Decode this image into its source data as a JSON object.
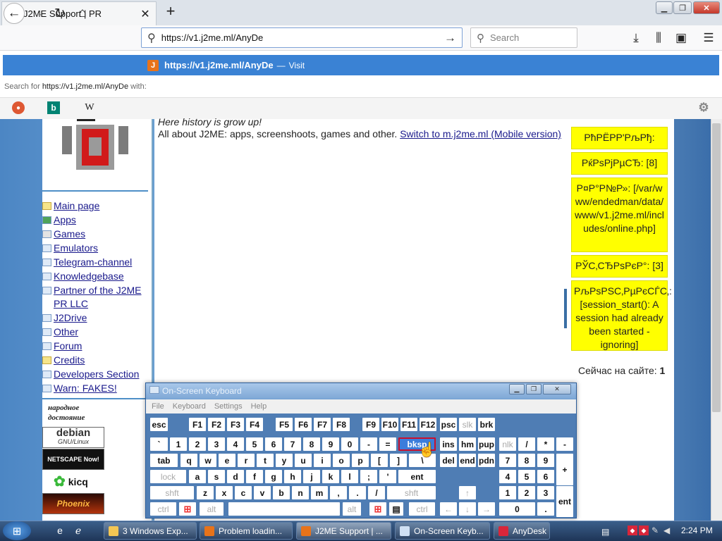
{
  "browser": {
    "tab_title": "J2ME Support | PR",
    "tab_favicon": "J",
    "url": "https://v1.j2me.ml/AnyDe",
    "search_placeholder": "Search",
    "dropdown": {
      "visit_url": "https://v1.j2me.ml/AnyDe",
      "visit_separator": "—",
      "visit_label": "Visit",
      "search_for_prefix": "Search for",
      "search_for_query": "https://v1.j2me.ml/AnyDe",
      "search_for_suffix": "with:",
      "engines": [
        "duckduckgo-icon",
        "bing-icon",
        "wikipedia-icon"
      ],
      "engine_labels": [
        "",
        "b",
        "W"
      ]
    },
    "icons": [
      "back-icon",
      "forward-icon",
      "reload-icon",
      "home-icon",
      "download-icon",
      "library-icon",
      "sidebar-icon",
      "menu-icon"
    ]
  },
  "page": {
    "tagline": "Here history is grow up!",
    "about_text": "All about J2ME: apps, screenshoots, games and other.",
    "switch_link": "Switch to m.j2me.ml (Mobile version)",
    "nav": [
      {
        "label": "Main page",
        "icon": "folder"
      },
      {
        "label": "Apps",
        "icon": "app"
      },
      {
        "label": "Games",
        "icon": "app"
      },
      {
        "label": "Emulators",
        "icon": "window"
      },
      {
        "label": "Telegram-channel",
        "icon": "window"
      },
      {
        "label": "Knowledgebase",
        "icon": "window"
      },
      {
        "label": "Partner of the J2ME PR LLC",
        "icon": "window"
      },
      {
        "label": "J2Drive",
        "icon": "window"
      },
      {
        "label": "Other",
        "icon": "window"
      },
      {
        "label": "Forum",
        "icon": "window"
      },
      {
        "label": "Credits",
        "icon": "app"
      },
      {
        "label": "Developers Section",
        "icon": "window"
      },
      {
        "label": "Warn: FAKES!",
        "icon": "window"
      }
    ],
    "badges": {
      "narodnoe": "народное достояние",
      "debian": "debian",
      "debian_sub": "GNU/Linux",
      "netscape": "NETSCAPE Now!",
      "kicq": "kicq",
      "phoenix": "Phoenix"
    },
    "info_boxes": [
      "РћРЁРР'РљРђ:",
      "РќРѕРјРµСЂ: [8]",
      "Р¤Р°Р№Р»: [/var/www/endedman/data/www/v1.j2me.ml/includes/online.php]",
      "РЎС‚СЂРѕРєР°: [3]",
      "РљРѕРЅС‚РµРєСЃС‚: [session_start(): A session had already been started - ignoring]"
    ],
    "online_label": "Сейчас на сайте:",
    "online_count": "1"
  },
  "osk": {
    "title": "On-Screen Keyboard",
    "menus": [
      "File",
      "Keyboard",
      "Settings",
      "Help"
    ],
    "rows": {
      "fn": [
        "esc",
        "F1",
        "F2",
        "F3",
        "F4",
        "F5",
        "F6",
        "F7",
        "F8",
        "F9",
        "F10",
        "F11",
        "F12",
        "psc",
        "slk",
        "brk"
      ],
      "num": [
        "`",
        "1",
        "2",
        "3",
        "4",
        "5",
        "6",
        "7",
        "8",
        "9",
        "0",
        "-",
        "=",
        "bksp",
        "ins",
        "hm",
        "pup",
        "nlk",
        "/",
        "*",
        "-"
      ],
      "q": [
        "tab",
        "q",
        "w",
        "e",
        "r",
        "t",
        "y",
        "u",
        "i",
        "o",
        "p",
        "[",
        "]",
        "\\",
        "del",
        "end",
        "pdn",
        "7",
        "8",
        "9",
        "+"
      ],
      "a": [
        "lock",
        "a",
        "s",
        "d",
        "f",
        "g",
        "h",
        "j",
        "k",
        "l",
        ";",
        "'",
        "ent",
        "4",
        "5",
        "6"
      ],
      "z": [
        "shft",
        "z",
        "x",
        "c",
        "v",
        "b",
        "n",
        "m",
        ",",
        ".",
        "/",
        "shft",
        "↑",
        "1",
        "2",
        "3",
        "ent"
      ],
      "ctrl": [
        "ctrl",
        "win",
        "alt",
        "",
        "alt",
        "win",
        "menu",
        "ctrl",
        "←",
        "↓",
        "→",
        "0",
        "."
      ]
    }
  },
  "taskbar": {
    "tasks": [
      {
        "label": "3 Windows Exp...",
        "icon": "folder-icon"
      },
      {
        "label": "Problem loadin...",
        "icon": "firefox-icon"
      },
      {
        "label": "J2ME Support | ...",
        "icon": "firefox-icon"
      },
      {
        "label": "On-Screen Keyb...",
        "icon": "keyboard-icon"
      },
      {
        "label": "AnyDesk",
        "icon": "anydesk-icon"
      }
    ],
    "clock": "2:24 PM"
  },
  "colors": {
    "accent": "#3a82d4",
    "info_box": "#ffff00",
    "link": "#1a1a8c",
    "osk_bg": "#4f7db4"
  }
}
